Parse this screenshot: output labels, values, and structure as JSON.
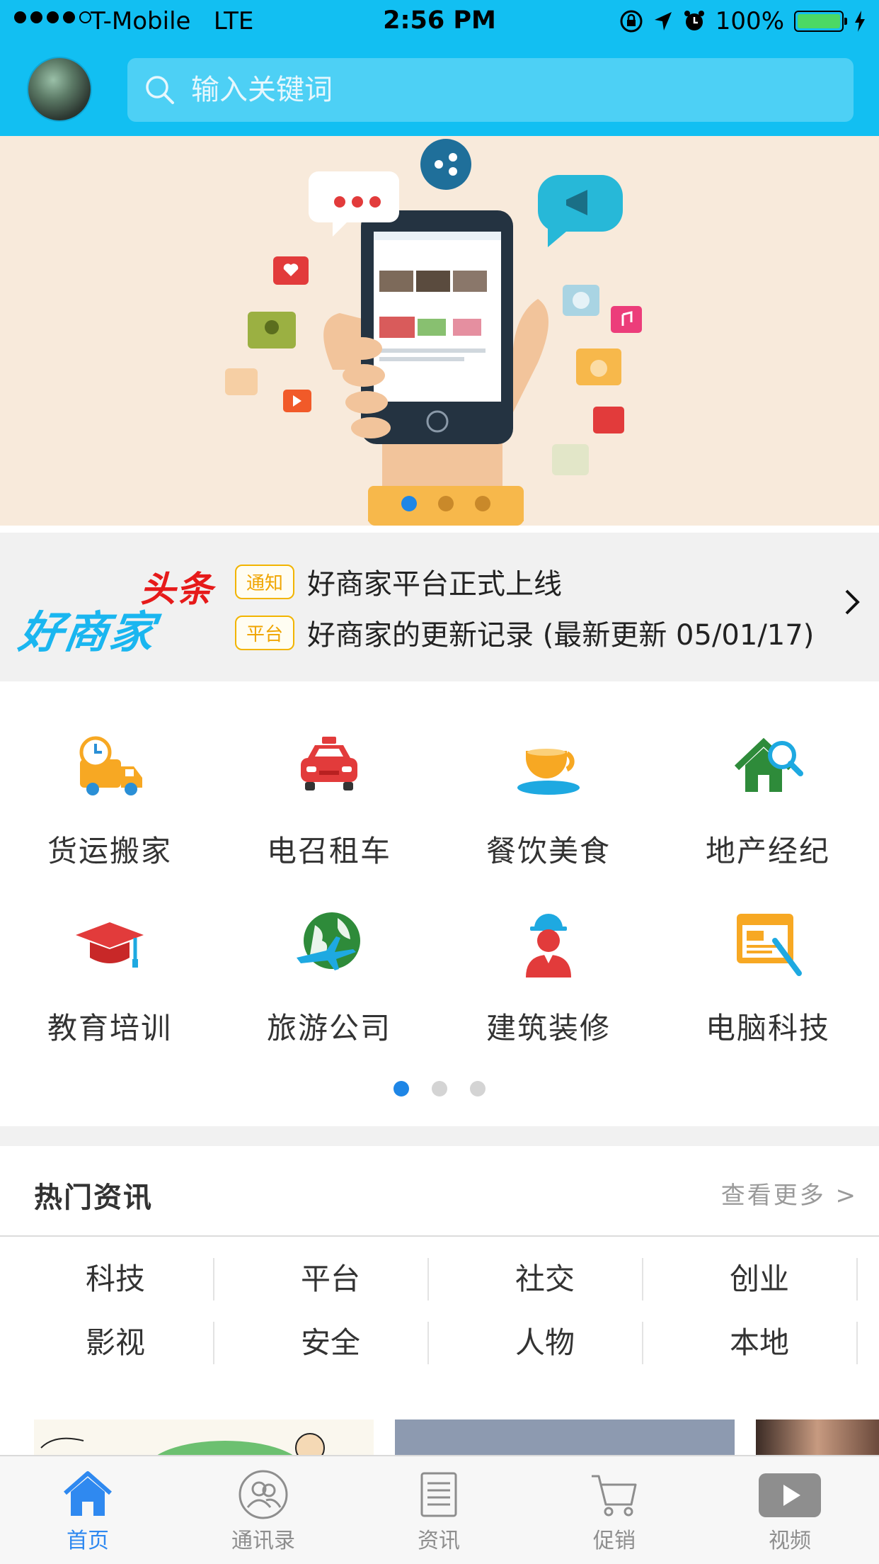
{
  "status_bar": {
    "carrier": "T-Mobile",
    "network": "LTE",
    "time": "2:56 PM",
    "battery": "100%",
    "battery_level": 1.0
  },
  "search": {
    "placeholder": "输入关键词"
  },
  "banner": {
    "page_count": 3,
    "active_page": 1
  },
  "headline": {
    "logo_top": "头条",
    "logo_brand": "好商家",
    "notices": [
      {
        "tag": "通知",
        "text": "好商家平台正式上线"
      },
      {
        "tag": "平台",
        "text": "好商家的更新记录 (最新更新 05/01/17)"
      }
    ]
  },
  "categories": {
    "items": [
      {
        "label": "货运搬家",
        "icon": "truck-icon"
      },
      {
        "label": "电召租车",
        "icon": "taxi-icon"
      },
      {
        "label": "餐饮美食",
        "icon": "coffee-cup-icon"
      },
      {
        "label": "地产经纪",
        "icon": "house-search-icon"
      },
      {
        "label": "教育培训",
        "icon": "graduation-cap-icon"
      },
      {
        "label": "旅游公司",
        "icon": "globe-airplane-icon"
      },
      {
        "label": "建筑装修",
        "icon": "construction-worker-icon"
      },
      {
        "label": "电脑科技",
        "icon": "computer-screen-icon"
      }
    ],
    "page_count": 3,
    "active_page": 1
  },
  "hot_news": {
    "title": "热门资讯",
    "more": "查看更多 >",
    "tags": [
      "科技",
      "平台",
      "社交",
      "创业",
      "影视",
      "安全",
      "人物",
      "本地"
    ]
  },
  "tab_bar": {
    "tabs": [
      {
        "label": "首页",
        "icon": "home-icon",
        "active": true
      },
      {
        "label": "通讯录",
        "icon": "contacts-icon",
        "active": false
      },
      {
        "label": "资讯",
        "icon": "news-document-icon",
        "active": false
      },
      {
        "label": "促销",
        "icon": "shopping-cart-icon",
        "active": false
      },
      {
        "label": "视频",
        "icon": "video-play-icon",
        "active": false
      }
    ]
  },
  "colors": {
    "primary": "#12bff2",
    "accent_blue": "#2f89f0",
    "tag_border": "#f2b400",
    "logo_red": "#e61a1a"
  }
}
